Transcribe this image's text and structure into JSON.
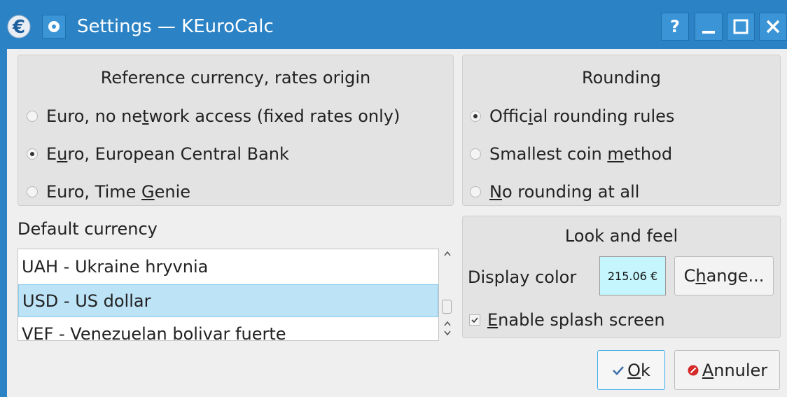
{
  "window": {
    "title": "Settings — KEuroCalc",
    "help_label": "?",
    "colors": {
      "titlebar": "#2b83c6",
      "selection": "#bde3f6",
      "swatch": "#c5f6fd"
    }
  },
  "reference": {
    "title": "Reference currency, rates origin",
    "options": [
      {
        "pre": "Euro, no ne",
        "ul": "t",
        "post": "work access (fixed rates only)",
        "checked": false
      },
      {
        "pre": "E",
        "ul": "u",
        "post": "ro, European Central Bank",
        "checked": true
      },
      {
        "pre": "Euro, Time ",
        "ul": "G",
        "post": "enie",
        "checked": false
      }
    ]
  },
  "rounding": {
    "title": "Rounding",
    "options": [
      {
        "pre": "Offic",
        "ul": "i",
        "post": "al rounding rules",
        "checked": true
      },
      {
        "pre": "Smallest coin ",
        "ul": "m",
        "post": "ethod",
        "checked": false
      },
      {
        "pre": "",
        "ul": "N",
        "post": "o rounding at all",
        "checked": false
      }
    ]
  },
  "default_currency": {
    "label": "Default currency",
    "items": [
      "UAH - Ukraine hryvnia",
      "USD - US dollar",
      "VEF - Venezuelan bolivar fuerte"
    ],
    "selected": "USD - US dollar"
  },
  "look": {
    "title": "Look and feel",
    "display_color_label": "Display color",
    "sample": "215.06 €",
    "change": {
      "pre": "C",
      "ul": "h",
      "post": "ange..."
    },
    "splash": {
      "pre": "",
      "ul": "E",
      "post": "nable splash screen",
      "checked": true
    }
  },
  "buttons": {
    "ok": {
      "pre": "",
      "ul": "O",
      "post": "k"
    },
    "cancel": {
      "pre": "",
      "ul": "A",
      "post": "nnuler"
    }
  }
}
